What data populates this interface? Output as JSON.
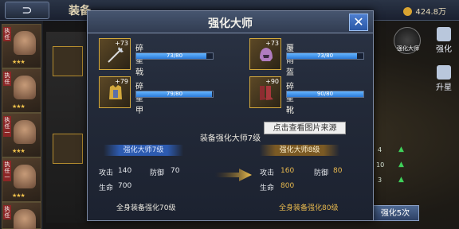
{
  "topbar": {
    "back_symbol": "⊃",
    "title": "装备",
    "gold": "424.8万"
  },
  "heroes": [
    {
      "tag": "执 任",
      "stars": "★★★"
    },
    {
      "tag": "执 任",
      "stars": "★★★"
    },
    {
      "tag": "执 任 一",
      "stars": "★★★"
    },
    {
      "tag": "执 任 一",
      "stars": "★★★"
    },
    {
      "tag": "执 任",
      "stars": "★★★"
    }
  ],
  "side_tabs": {
    "strengthen": "强化",
    "star_up": "升星",
    "master_small": "强化大师"
  },
  "background_stats": {
    "row1": "4",
    "row2": "10",
    "row3": "3"
  },
  "strengthen_five": "强化5次",
  "modal": {
    "title": "强化大师",
    "close_symbol": "✕",
    "items": [
      {
        "name": "碎星戟",
        "plus": "+73",
        "progress_text": "73/80",
        "progress": 0.9125,
        "icon": "halberd-icon"
      },
      {
        "name": "覆雨盔",
        "plus": "+73",
        "progress_text": "73/80",
        "progress": 0.9125,
        "icon": "helmet-icon"
      },
      {
        "name": "碎星甲",
        "plus": "+79",
        "progress_text": "79/80",
        "progress": 0.9875,
        "icon": "armor-icon"
      },
      {
        "name": "碎星靴",
        "plus": "+90",
        "progress_text": "90/80",
        "progress": 1.0,
        "icon": "boots-icon"
      }
    ],
    "master_line": "装备强化大师7级",
    "tooltip": "点击查看图片来源",
    "current_level": "强化大师7级",
    "next_level": "强化大师8级",
    "current": {
      "attack_label": "攻击",
      "attack": "140",
      "defense_label": "防御",
      "defense": "70",
      "hp_label": "生命",
      "hp": "700"
    },
    "next": {
      "attack_label": "攻击",
      "attack": "160",
      "defense_label": "防御",
      "defense": "80",
      "hp_label": "生命",
      "hp": "800"
    },
    "current_requirement": "全身装备强化70级",
    "next_requirement": "全身装备强化80级"
  }
}
